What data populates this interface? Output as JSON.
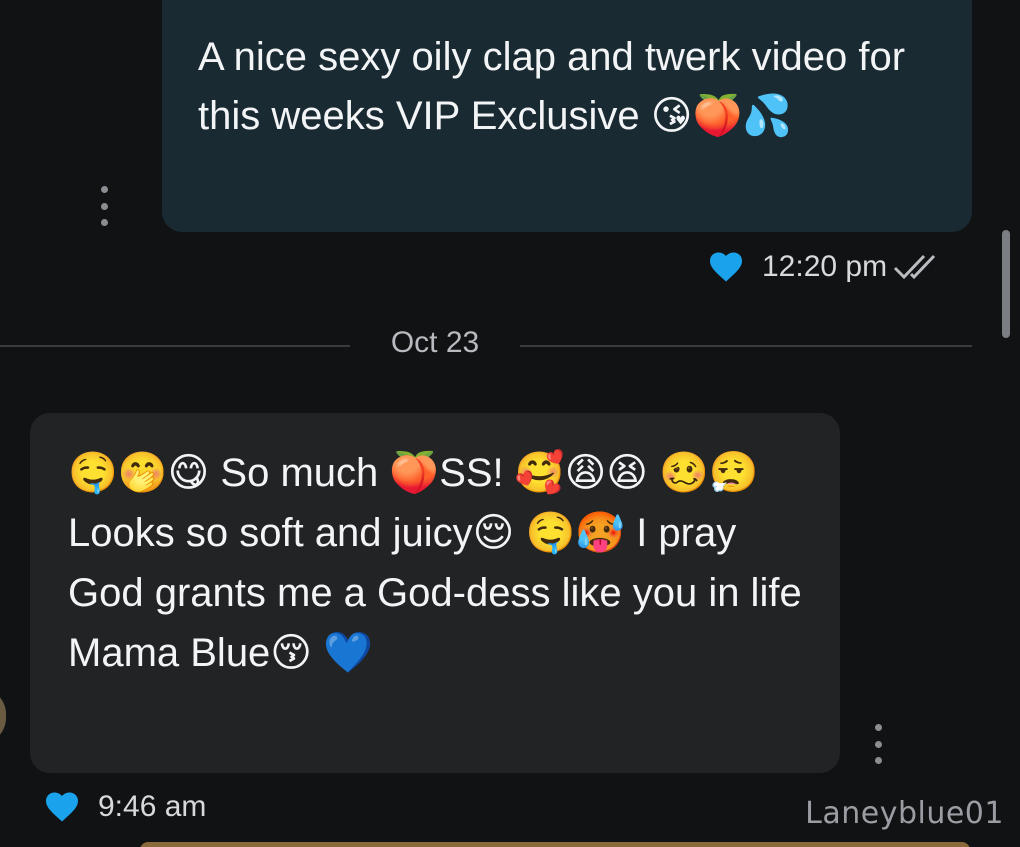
{
  "messages": {
    "outgoing": {
      "text": "A nice sexy oily clap and twerk video for this weeks VIP Exclusive 😘🍑💦",
      "time": "12:20 pm",
      "status_icon": "double-check-icon",
      "reaction_icon": "heart-icon"
    },
    "date_divider": "Oct 23",
    "incoming": {
      "text": "🤤🤭😋 So much 🍑SS! 🥰😩😫 🥴😮‍💨 Looks so soft and juicy😌 🤤🥵 I pray God grants me a God-dess like you in life Mama Blue😚 💙",
      "time": "9:46 am",
      "reaction_icon": "heart-icon",
      "sender": "Laneyblue01"
    }
  },
  "colors": {
    "background": "#111214",
    "outgoing_bubble": "#192a33",
    "incoming_bubble": "#222325",
    "heart": "#1aa3ec",
    "text": "#f2f4f5"
  },
  "icons": {
    "more": "vertical-dots-icon"
  }
}
